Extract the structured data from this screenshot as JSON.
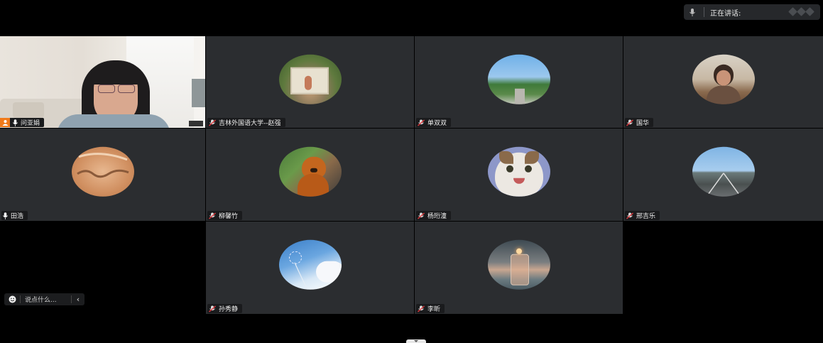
{
  "speaking_bar": {
    "label": "正在讲话:"
  },
  "participants": [
    {
      "name": "问亚娟"
    },
    {
      "name": "吉林外国语大学--赵强"
    },
    {
      "name": "单双双"
    },
    {
      "name": "国华"
    },
    {
      "name": "田浩"
    },
    {
      "name": "柳馨竹"
    },
    {
      "name": "杨珩潼"
    },
    {
      "name": "邢吉乐"
    },
    {
      "name": "孙秀静"
    },
    {
      "name": "李昕"
    }
  ],
  "chat": {
    "placeholder": "说点什么..."
  }
}
